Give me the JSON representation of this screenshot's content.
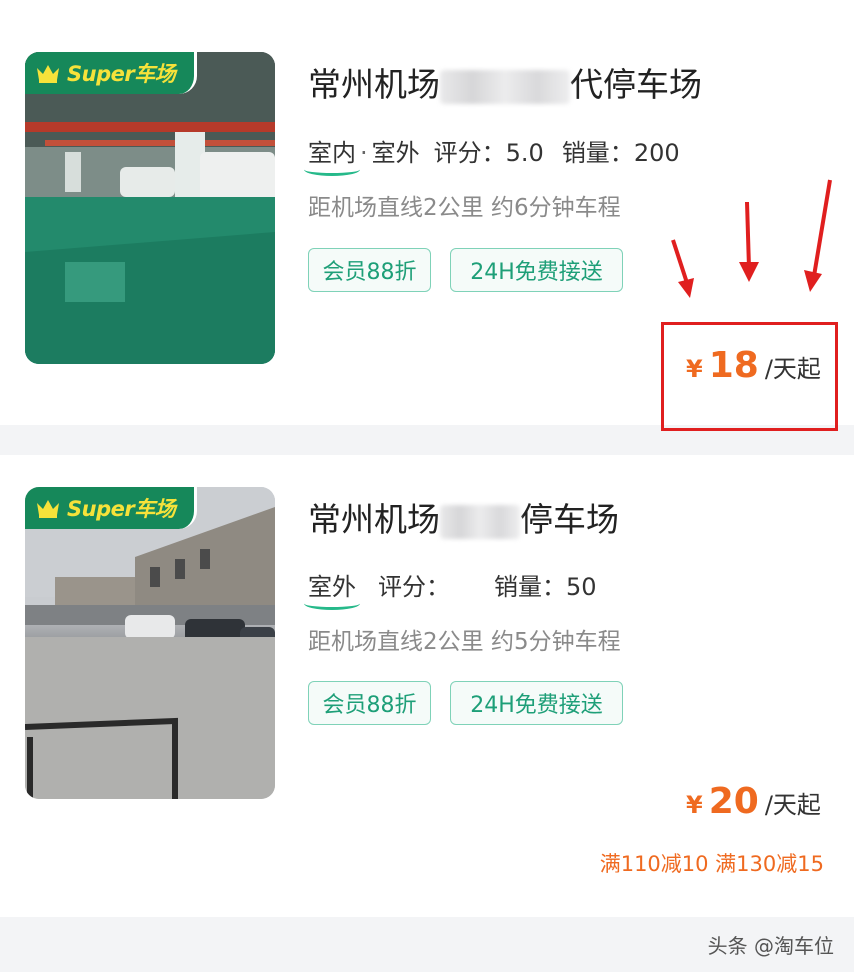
{
  "listings": [
    {
      "badge": "Super车场",
      "title_prefix": "常州机场",
      "title_suffix": "代停车场",
      "tags": [
        "室内",
        "室外"
      ],
      "tag_separator": "·",
      "rating_label": "评分：",
      "rating_value": "5.0",
      "sales_label": "销量：",
      "sales_value": "200",
      "distance": "距机场直线2公里 约6分钟车程",
      "chips": [
        "会员88折",
        "24H免费接送"
      ],
      "price_symbol": "¥",
      "price": "18",
      "price_unit": "/天起"
    },
    {
      "badge": "Super车场",
      "title_prefix": "常州机场",
      "title_suffix": "停车场",
      "tags": [
        "室外"
      ],
      "rating_label": "评分：",
      "rating_value": "",
      "sales_label": "销量：",
      "sales_value": "50",
      "distance": "距机场直线2公里 约5分钟车程",
      "chips": [
        "会员88折",
        "24H免费接送"
      ],
      "price_symbol": "¥",
      "price": "20",
      "price_unit": "/天起",
      "discount": "满110减10 满130减15"
    }
  ],
  "watermark": "头条 @淘车位",
  "colors": {
    "accent_green": "#1e9f78",
    "badge_green": "#16885a",
    "price_orange": "#ef6a20",
    "highlight_red": "#e01f1f"
  },
  "icons": [
    "crown-icon",
    "red-arrow-icon"
  ]
}
